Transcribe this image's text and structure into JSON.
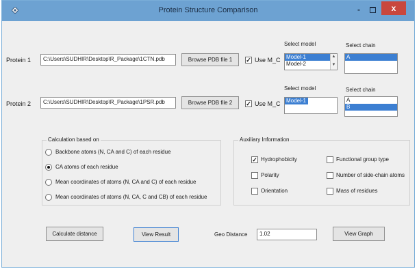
{
  "window": {
    "title": "Protein Structure Comparison",
    "minimize_glyph": "-",
    "close_glyph": "x"
  },
  "protein1": {
    "label": "Protein 1",
    "path": "C:\\Users\\SUDHIR\\Desktop\\R_Package\\1CTN.pdb",
    "browse_label": "Browse PDB file 1",
    "use_mc_label": "Use M_C",
    "use_mc_checked": true,
    "model_label": "Select model",
    "models": [
      "Model-1",
      "Model-2"
    ],
    "selected_model": "Model-1",
    "chain_label": "Select chain",
    "chains": [
      "A"
    ],
    "selected_chain": "A"
  },
  "protein2": {
    "label": "Protein 2",
    "path": "C:\\Users\\SUDHIR\\Desktop\\R_Package\\1PSR.pdb",
    "browse_label": "Browse PDB file 2",
    "use_mc_label": "Use M_C",
    "use_mc_checked": true,
    "model_label": "Select model",
    "models": [
      "Model-1"
    ],
    "selected_model": "Model-1",
    "chain_label": "Select chain",
    "chains": [
      "A",
      "B"
    ],
    "selected_chain": "B"
  },
  "calculation": {
    "title": "Calculation based on",
    "options": [
      "Backbone atoms (N, CA and C) of each residue",
      "CA atoms of each residue",
      "Mean coordinates of atoms (N, CA and C) of each residue",
      "Mean coordinates of atoms (N, CA, C and CB) of each residue"
    ],
    "selected_index": 1
  },
  "auxiliary": {
    "title": "Auxiliary Information",
    "left": [
      {
        "label": "Hydrophobicity",
        "checked": true
      },
      {
        "label": "Polarity",
        "checked": false
      },
      {
        "label": "Orientation",
        "checked": false
      }
    ],
    "right": [
      {
        "label": "Functional group type",
        "checked": false
      },
      {
        "label": "Number of side-chain atoms",
        "checked": false
      },
      {
        "label": "Mass of residues",
        "checked": false
      }
    ]
  },
  "actions": {
    "calculate_label": "Calculate distance",
    "view_result_label": "View Result",
    "geo_distance_label": "Geo Distance",
    "geo_distance_value": "1.02",
    "view_graph_label": "View Graph"
  },
  "colors": {
    "titlebar": "#6da2d2",
    "selection": "#3c7fd2",
    "close": "#c9473d"
  }
}
